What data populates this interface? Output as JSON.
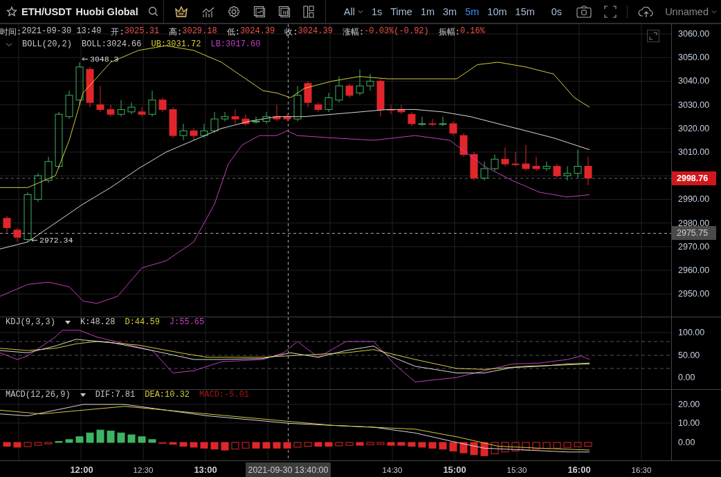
{
  "toolbar": {
    "symbol": "ETH/USDT",
    "exchange": "Huobi Global",
    "intervals": [
      {
        "label": "All",
        "kind": "dropdown",
        "selected": false
      },
      {
        "label": "1s",
        "kind": "interval",
        "selected": false
      },
      {
        "label": "Time",
        "kind": "interval",
        "selected": false
      },
      {
        "label": "1m",
        "kind": "interval",
        "selected": false
      },
      {
        "label": "3m",
        "kind": "interval",
        "selected": false
      },
      {
        "label": "5m",
        "kind": "interval",
        "selected": true
      },
      {
        "label": "10m",
        "kind": "interval",
        "selected": false
      },
      {
        "label": "15m",
        "kind": "interval",
        "selected": false
      }
    ],
    "countdown": "0s",
    "layout_name": "Unnamed"
  },
  "ohlc_info": [
    {
      "label": "时间:",
      "value": "2021-09-30 13:40",
      "color": "#c8c8c8"
    },
    {
      "label": "开:",
      "value": "3025.31",
      "color": "#f0504a"
    },
    {
      "label": "高:",
      "value": "3029.18",
      "color": "#f0504a"
    },
    {
      "label": "低:",
      "value": "3024.39",
      "color": "#f0504a"
    },
    {
      "label": "收:",
      "value": "3024.39",
      "color": "#f0504a"
    },
    {
      "label": "涨幅:",
      "value": "-0.03%(-0.92)",
      "color": "#f0504a"
    },
    {
      "label": "振幅:",
      "value": "0.16%",
      "color": "#f0504a"
    }
  ],
  "boll": {
    "title": "BOLL(20,2)",
    "values": [
      {
        "text": "BOLL:3024.66",
        "color": "#c8c8c8"
      },
      {
        "text": "UB:3031.72",
        "color": "#d4cc3a"
      },
      {
        "text": "LB:3017.60",
        "color": "#c23fc2"
      }
    ]
  },
  "markers": {
    "high": "3048.3",
    "low": "2972.34"
  },
  "price_axis": {
    "labels": [
      "3060.00",
      "3050.00",
      "3040.00",
      "3030.00",
      "3020.00",
      "3010.00",
      "2990.00",
      "2980.00",
      "2970.00",
      "2960.00",
      "2950.00"
    ],
    "last_price": "2998.76",
    "crosshair_price": "2975.75"
  },
  "kdj": {
    "title": "KDJ(9,3,3)",
    "values": [
      {
        "text": "K:48.28",
        "color": "#c8c8c8"
      },
      {
        "text": "D:44.59",
        "color": "#d4cc3a"
      },
      {
        "text": "J:55.65",
        "color": "#c23fc2"
      }
    ],
    "axis": [
      "100.00",
      "50.00",
      "0.00"
    ]
  },
  "macd": {
    "title": "MACD(12,26,9)",
    "values": [
      {
        "text": "DIF:7.81",
        "color": "#c8c8c8"
      },
      {
        "text": "DEA:10.32",
        "color": "#d4cc3a"
      },
      {
        "text": "MACD:-5.01",
        "color": "#a01818"
      }
    ],
    "axis": [
      "20.00",
      "10.00",
      "0.00"
    ]
  },
  "time_axis": {
    "labels": [
      {
        "text": "12:00",
        "major": true
      },
      {
        "text": "12:30",
        "major": false
      },
      {
        "text": "13:00",
        "major": true
      },
      {
        "text": "14:30",
        "major": false
      },
      {
        "text": "15:00",
        "major": true
      },
      {
        "text": "15:30",
        "major": false
      },
      {
        "text": "16:00",
        "major": true
      },
      {
        "text": "16:30",
        "major": false
      }
    ],
    "crosshair_time": "2021-09-30 13:40:00"
  }
}
